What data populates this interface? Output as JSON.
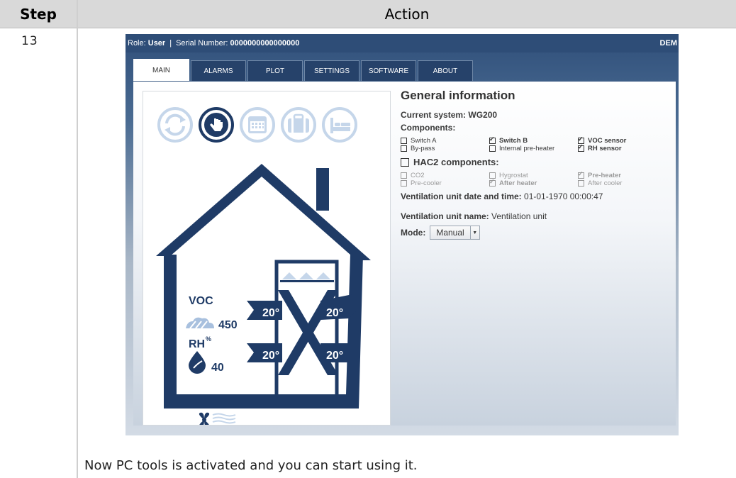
{
  "doc": {
    "col_step": "Step",
    "col_action": "Action",
    "step_number": "13",
    "footer_text": "Now PC tools is activated and you can start using it."
  },
  "app": {
    "role_label": "Role:",
    "role_value": "User",
    "serial_label": "Serial Number:",
    "serial_value": "0000000000000000",
    "mode_badge": "DEM",
    "tabs": [
      "MAIN",
      "ALARMS",
      "PLOT",
      "SETTINGS",
      "SOFTWARE",
      "ABOUT"
    ],
    "active_tab": "MAIN",
    "house": {
      "voc_label": "VOC",
      "voc_value": "450",
      "rh_label": "RH",
      "rh_unit": "%",
      "rh_value": "40",
      "temps": [
        "20°",
        "20°",
        "20°",
        "20°"
      ]
    },
    "mode_icons": [
      "auto-cycle-icon",
      "manual-hand-icon",
      "calendar-icon",
      "suitcase-icon",
      "bed-icon"
    ],
    "info": {
      "title": "General information",
      "current_system_label": "Current system:",
      "current_system_value": "WG200",
      "components_label": "Components:",
      "components": [
        {
          "label": "Switch A",
          "checked": false,
          "bold": false
        },
        {
          "label": "Switch B",
          "checked": true,
          "bold": true
        },
        {
          "label": "VOC sensor",
          "checked": true,
          "bold": true
        },
        {
          "label": "By-pass",
          "checked": false,
          "bold": false
        },
        {
          "label": "Internal pre-heater",
          "checked": false,
          "bold": false
        },
        {
          "label": "RH sensor",
          "checked": true,
          "bold": true
        }
      ],
      "hac2_label": "HAC2 components:",
      "hac2_components": [
        {
          "label": "CO2",
          "checked": false,
          "bold": false
        },
        {
          "label": "Hygrostat",
          "checked": false,
          "bold": false
        },
        {
          "label": "Pre-heater",
          "checked": true,
          "bold": true
        },
        {
          "label": "Pre-cooler",
          "checked": false,
          "bold": false
        },
        {
          "label": "After heater",
          "checked": true,
          "bold": true
        },
        {
          "label": "After cooler",
          "checked": false,
          "bold": false
        }
      ],
      "datetime_label": "Ventilation unit date and time:",
      "datetime_value": "01-01-1970 00:00:47",
      "name_label": "Ventilation unit name:",
      "name_value": "Ventilation unit",
      "mode_label": "Mode:",
      "mode_value": "Manual"
    },
    "colors": {
      "titlebar": "#2e4d77",
      "house": "#1f3b66",
      "icon_faded": "#c5d6ea"
    }
  }
}
